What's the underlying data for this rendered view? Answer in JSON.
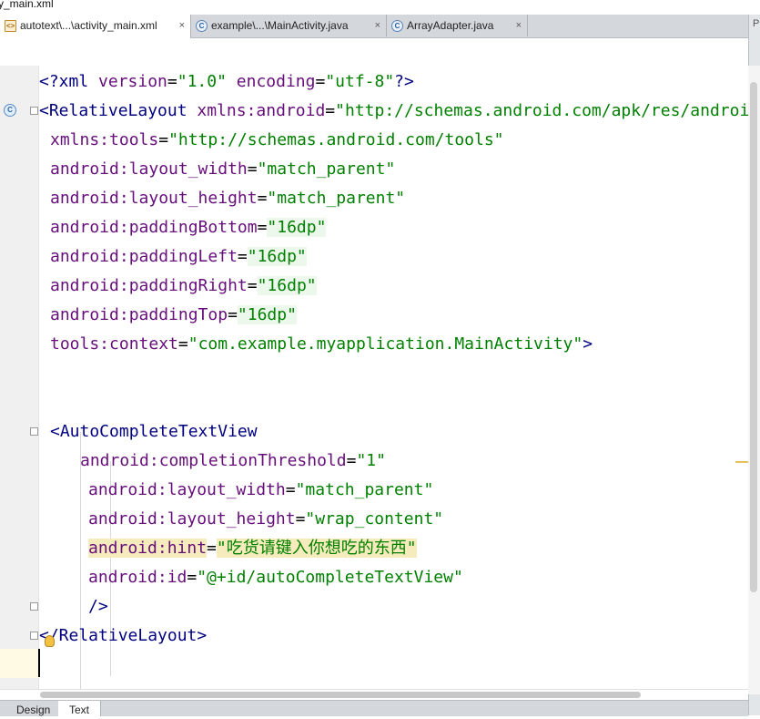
{
  "window": {
    "title_fragment": "y_main.xml"
  },
  "tabs": [
    {
      "label": "autotext\\...\\activity_main.xml",
      "icon": "xml-file-icon",
      "active": true
    },
    {
      "label": "example\\...\\MainActivity.java",
      "icon": "class-c-icon",
      "active": false
    },
    {
      "label": "ArrayAdapter.java",
      "icon": "class-c-icon",
      "active": false
    }
  ],
  "tab_close_symbol": "×",
  "right_panel_letter": "P",
  "editor": {
    "lines": [
      [
        "<?xml version=\"1.0\" encoding=\"utf-8\"?>"
      ],
      [
        "<RelativeLayout xmlns:android=\"http://schemas.android.com/apk/res/android\""
      ],
      [
        "    xmlns:tools=\"http://schemas.android.com/tools\""
      ],
      [
        "    android:layout_width=\"match_parent\""
      ],
      [
        "    android:layout_height=\"match_parent\""
      ],
      [
        "    android:paddingBottom=\"16dp\""
      ],
      [
        "    android:paddingLeft=\"16dp\""
      ],
      [
        "    android:paddingRight=\"16dp\""
      ],
      [
        "    android:paddingTop=\"16dp\""
      ],
      [
        "    tools:context=\"com.example.myapplication.MainActivity\">"
      ],
      [
        ""
      ],
      [
        ""
      ],
      [
        "    <AutoCompleteTextView"
      ],
      [
        "        android:completionThreshold=\"1\""
      ],
      [
        "        android:layout_width=\"match_parent\""
      ],
      [
        "        android:layout_height=\"wrap_content\""
      ],
      [
        "        android:hint=\"吃货请键入你想吃的东西\""
      ],
      [
        "        android:id=\"@+id/autoCompleteTextView\""
      ],
      [
        "        />"
      ],
      [
        "</RelativeLayout>"
      ]
    ]
  },
  "bottom_tabs": [
    {
      "label": "Design",
      "active": false
    },
    {
      "label": "Text",
      "active": true
    }
  ],
  "colors": {
    "tag": "#000080",
    "attribute": "#660e7a",
    "value": "#008000",
    "current_line": "#fffae3"
  }
}
